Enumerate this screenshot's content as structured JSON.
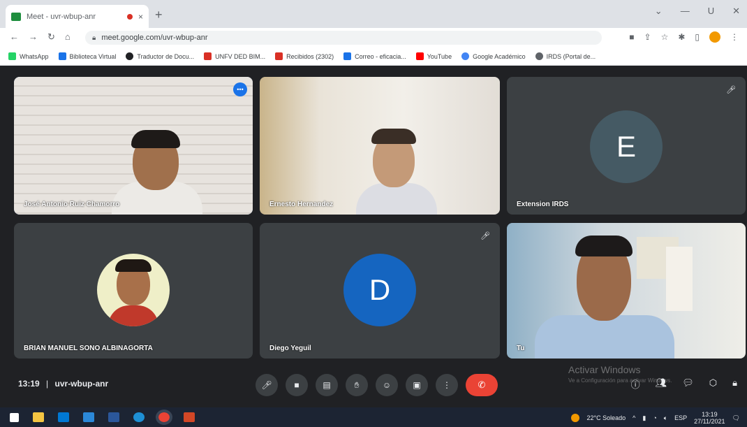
{
  "browser": {
    "tab_title": "Meet - uvr-wbup-anr",
    "tab_close": "×",
    "new_tab": "+",
    "url": "meet.google.com/uvr-wbup-anr",
    "window_controls": [
      "⌄",
      "—",
      "U",
      "✕"
    ]
  },
  "bookmarks": [
    {
      "label": "WhatsApp",
      "color": "#25d366"
    },
    {
      "label": "Biblioteca Virtual",
      "color": "#1a73e8"
    },
    {
      "label": "Traductor de Docu...",
      "color": "#202124"
    },
    {
      "label": "UNFV   DED   BIM...",
      "color": "#d93025"
    },
    {
      "label": "Recibidos (2302)",
      "color": "#d93025"
    },
    {
      "label": "Correo - eficacia...",
      "color": "#1a73e8"
    },
    {
      "label": "YouTube",
      "color": "#ff0000"
    },
    {
      "label": "Google Académico",
      "color": "#4285f4"
    },
    {
      "label": "IRDS (Portal de...",
      "color": "#5f6368"
    }
  ],
  "participants": [
    {
      "name": "José Antonio Ruiz Chamorro",
      "type": "video"
    },
    {
      "name": "Ernesto Hernandez",
      "type": "video"
    },
    {
      "name": "Extension IRDS",
      "type": "avatar",
      "initial": "E",
      "color": "#455a64"
    },
    {
      "name": "BRIAN MANUEL SONO ALBINAGORTA",
      "type": "photo"
    },
    {
      "name": "Diego Yeguil",
      "type": "avatar",
      "initial": "D",
      "color": "#1565c0"
    },
    {
      "name": "Tu",
      "type": "video"
    }
  ],
  "meeting": {
    "time": "13:19",
    "separator": "|",
    "code": "uvr-wbup-anr"
  },
  "watermark": {
    "title": "Activar Windows",
    "subtitle": "Ve a Configuración para activar Windows."
  },
  "taskbar": {
    "temp": "22°C  Soleado",
    "lang": "ESP",
    "time": "13:19",
    "date": "27/11/2021"
  }
}
